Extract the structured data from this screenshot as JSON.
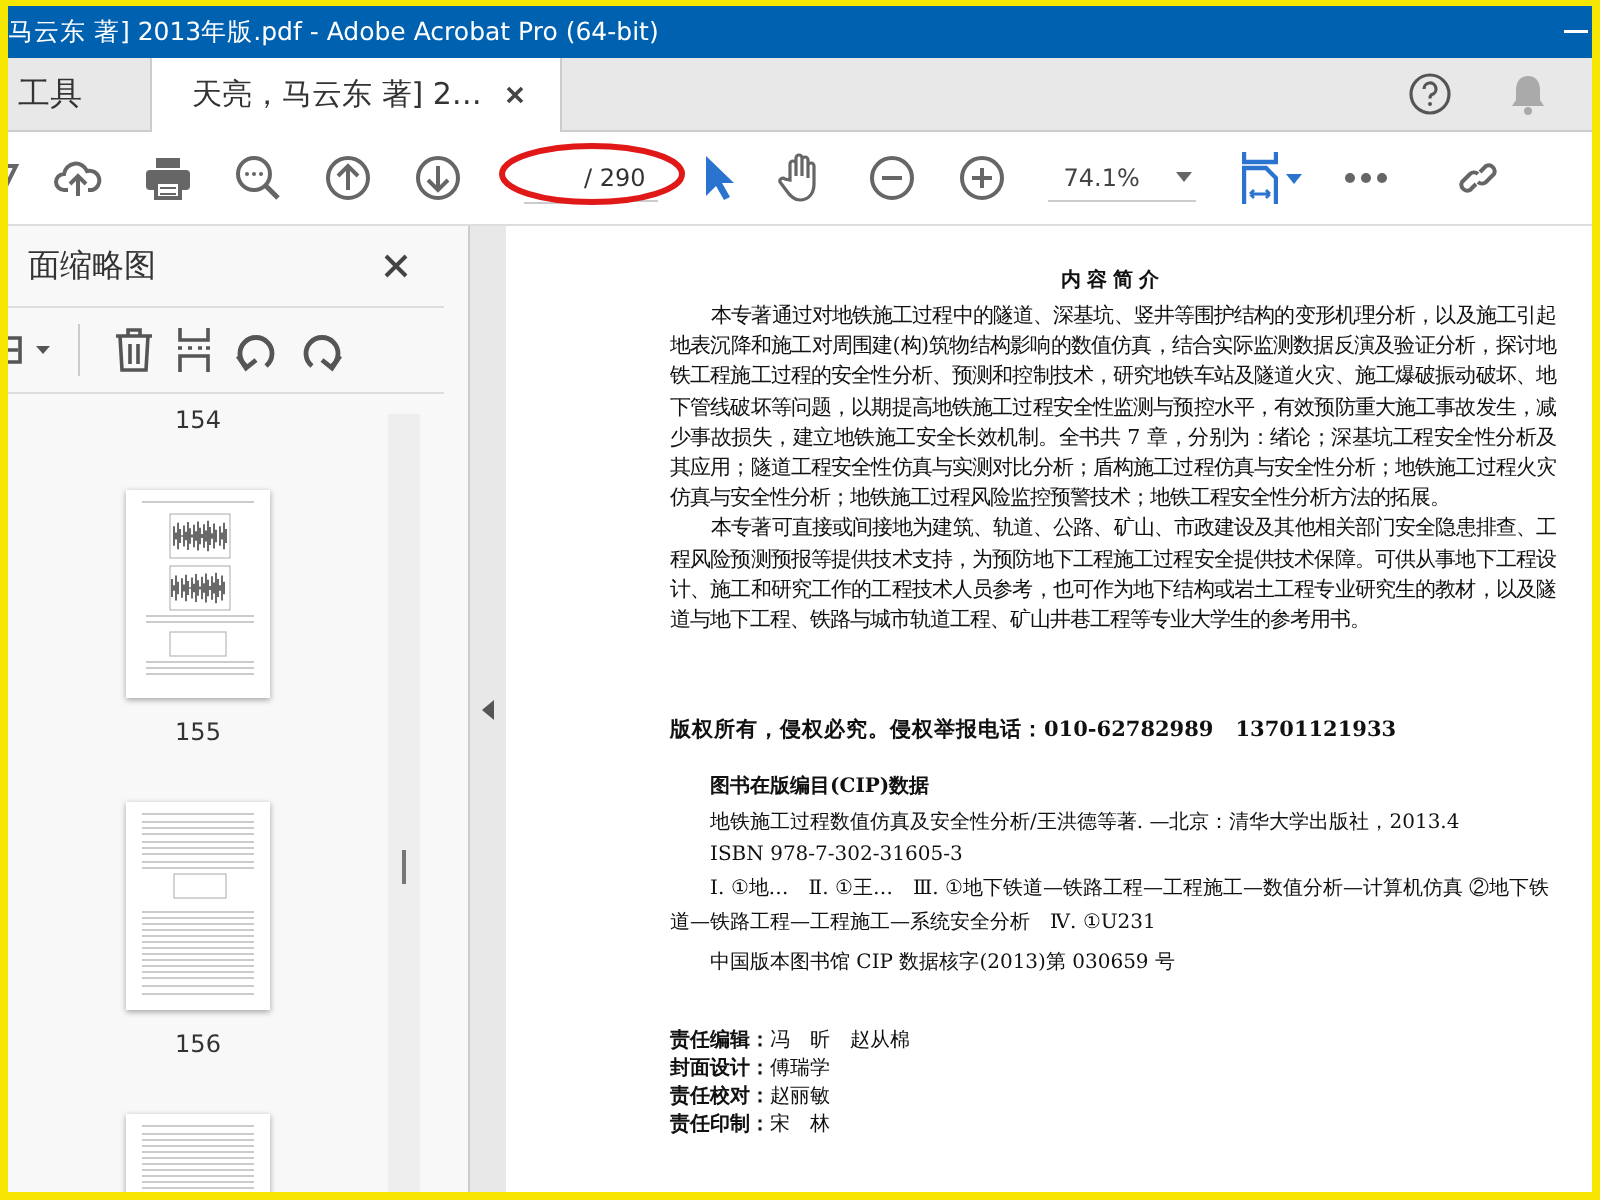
{
  "window": {
    "title": "马云东 著] 2013年版.pdf - Adobe Acrobat Pro (64-bit)"
  },
  "tabs": [
    {
      "label": "工具",
      "selected": false,
      "closable": false
    },
    {
      "label": "天亮，马云东 著] 2…",
      "selected": true,
      "closable": true
    }
  ],
  "toolbar": {
    "page_total": "/ 290",
    "zoom": "74.1%"
  },
  "thumbnails_panel": {
    "title": "面缩略图",
    "pages": [
      {
        "label": "154",
        "kind": "charts"
      },
      {
        "label": "155",
        "kind": "table_text"
      },
      {
        "label": "156",
        "kind": "text_chart"
      }
    ]
  },
  "document": {
    "heading": "内容简介",
    "paragraphs": [
      "本专著通过对地铁施工过程中的隧道、深基坑、竖井等围护结构的变形机理分析，以及施工引起地表沉降和施工对周围建(构)筑物结构影响的数值仿真，结合实际监测数据反演及验证分析，探讨地铁工程施工过程的安全性分析、预测和控制技术，研究地铁车站及隧道火灾、施工爆破振动破坏、地下管线破坏等问题，以期提高地铁施工过程安全性监测与预控水平，有效预防重大施工事故发生，减少事故损失，建立地铁施工安全长效机制。全书共 7 章，分别为：绪论；深基坑工程安全性分析及其应用；隧道工程安全性仿真与实测对比分析；盾构施工过程仿真与安全性分析；地铁施工过程火灾仿真与安全性分析；地铁施工过程风险监控预警技术；地铁工程安全性分析方法的拓展。",
      "本专著可直接或间接地为建筑、轨道、公路、矿山、市政建设及其他相关部门安全隐患排查、工程风险预测预报等提供技术支持，为预防地下工程施工过程安全提供技术保障。可供从事地下工程设计、施工和研究工作的工程技术人员参考，也可作为地下结构或岩土工程专业研究生的教材，以及隧道与地下工程、铁路与城市轨道工程、矿山井巷工程等专业大学生的参考用书。"
    ],
    "copyright": "版权所有，侵权必究。侵权举报电话：010-62782989　13701121933",
    "cip_title": "图书在版编目(CIP)数据",
    "cip_lines": [
      "地铁施工过程数值仿真及安全性分析/王洪德等著. —北京：清华大学出版社，2013.4",
      "ISBN 978-7-302-31605-3"
    ],
    "cip_classification": "Ⅰ. ①地…　Ⅱ. ①王…　Ⅲ. ①地下铁道—铁路工程—工程施工—数值分析—计算机仿真 ②地下铁道—铁路工程—工程施工—系统安全分析　Ⅳ. ①U231",
    "cip_number": "中国版本图书馆 CIP 数据核字(2013)第 030659 号",
    "credits": [
      "**责任编辑：**冯　昕　赵从棉",
      "**封面设计：**傅瑞学",
      "**责任校对：**赵丽敏",
      "**责任印制：**宋　林"
    ]
  }
}
